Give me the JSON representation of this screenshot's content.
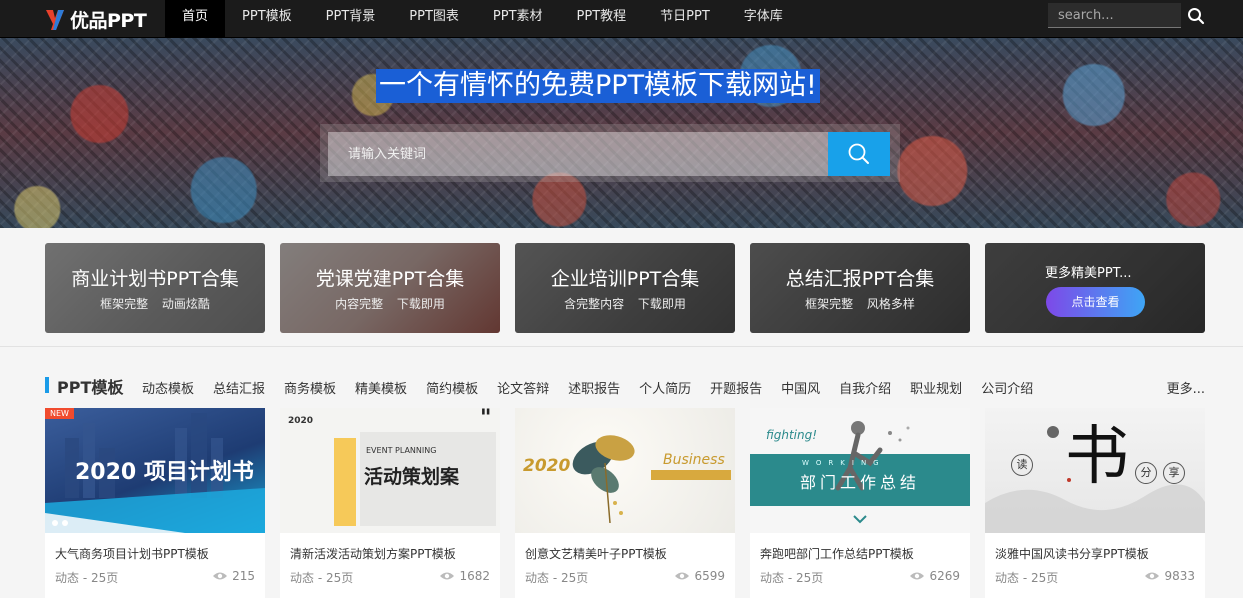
{
  "nav": {
    "logo_text": "优品PPT",
    "items": [
      "首页",
      "PPT模板",
      "PPT背景",
      "PPT图表",
      "PPT素材",
      "PPT教程",
      "节日PPT",
      "字体库"
    ],
    "search_placeholder": "search..."
  },
  "hero": {
    "title": "一个有情怀的免费PPT模板下载网站!",
    "search_placeholder": "请输入关键词"
  },
  "cards": [
    {
      "title": "商业计划书PPT合集",
      "sub": "框架完整 动画炫酷"
    },
    {
      "title": "党课党建PPT合集",
      "sub": "内容完整 下载即用"
    },
    {
      "title": "企业培训PPT合集",
      "sub": "含完整内容 下载即用"
    },
    {
      "title": "总结汇报PPT合集",
      "sub": "框架完整 风格多样"
    }
  ],
  "more_card": {
    "title": "更多精美PPT...",
    "button": "点击查看"
  },
  "section": {
    "title": "PPT模板",
    "tags": [
      "动态模板",
      "总结汇报",
      "商务模板",
      "精美模板",
      "简约模板",
      "论文答辩",
      "述职报告",
      "个人简历",
      "开题报告",
      "中国风",
      "自我介绍",
      "职业规划",
      "公司介绍"
    ],
    "more": "更多..."
  },
  "templates": [
    {
      "name": "大气商务项目计划书PPT模板",
      "meta": "动态 - 25页",
      "views": "215",
      "thumb_text": "2020 项目计划书",
      "badge": "NEW"
    },
    {
      "name": "清新活泼活动策划方案PPT模板",
      "meta": "动态 - 25页",
      "views": "1682",
      "thumb_text": "活动策划案",
      "thumb_sub": "EVENT PLANNING",
      "thumb_year": "2020"
    },
    {
      "name": "创意文艺精美叶子PPT模板",
      "meta": "动态 - 25页",
      "views": "6599",
      "thumb_text": "Business",
      "thumb_year": "2020"
    },
    {
      "name": "奔跑吧部门工作总结PPT模板",
      "meta": "动态 - 25页",
      "views": "6269",
      "thumb_text": "部门工作总结",
      "thumb_sub": "fighting!",
      "thumb_small": "WORKING"
    },
    {
      "name": "淡雅中国风读书分享PPT模板",
      "meta": "动态 - 25页",
      "views": "9833",
      "thumb_text": "书",
      "thumb_chars": [
        "读",
        "分",
        "享"
      ]
    }
  ]
}
